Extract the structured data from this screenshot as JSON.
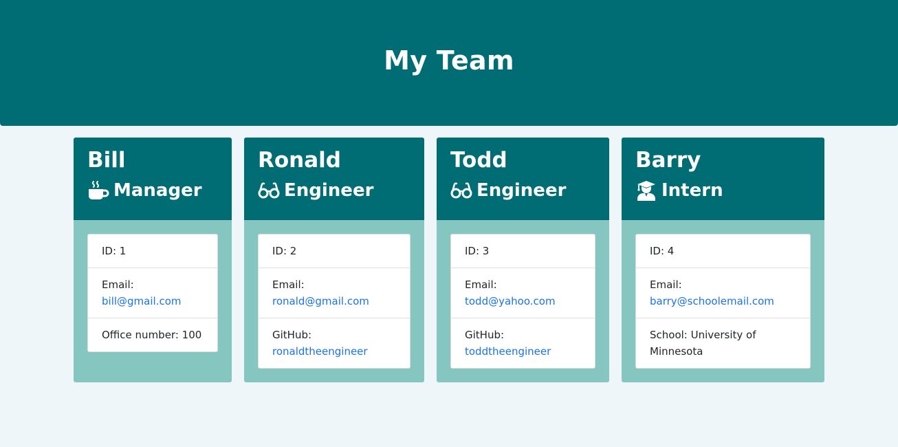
{
  "header": {
    "title": "My Team"
  },
  "colors": {
    "header_bg": "#006d75",
    "card_body_bg": "#86c6c1",
    "page_bg": "#eef6f9",
    "link": "#1a73e8"
  },
  "cards": [
    {
      "name": "Bill",
      "role": "Manager",
      "role_icon": "coffee-mug-icon",
      "id_text": "ID: 1",
      "email_label": "Email:",
      "email": "bill@gmail.com",
      "extra_text": "Office number: 100"
    },
    {
      "name": "Ronald",
      "role": "Engineer",
      "role_icon": "glasses-icon",
      "id_text": "ID: 2",
      "email_label": "Email:",
      "email": "ronald@gmail.com",
      "extra_label": "GitHub:",
      "extra_link": "ronaldtheengineer"
    },
    {
      "name": "Todd",
      "role": "Engineer",
      "role_icon": "glasses-icon",
      "id_text": "ID: 3",
      "email_label": "Email:",
      "email": "todd@yahoo.com",
      "extra_label": "GitHub:",
      "extra_link": "toddtheengineer"
    },
    {
      "name": "Barry",
      "role": "Intern",
      "role_icon": "graduate-icon",
      "id_text": "ID: 4",
      "email_label": "Email:",
      "email": "barry@schoolemail.com",
      "extra_text": "School: University of Minnesota"
    }
  ]
}
